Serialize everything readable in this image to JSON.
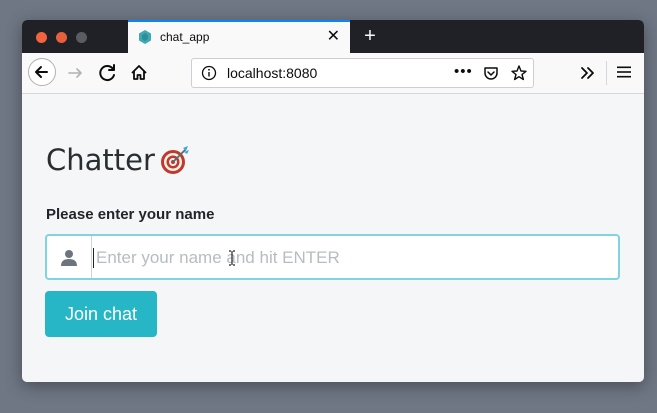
{
  "browser": {
    "tab": {
      "title": "chat_app",
      "close_glyph": "✕"
    },
    "new_tab_glyph": "+",
    "url": "localhost:8080",
    "url_more_glyph": "•••",
    "icons": {
      "back": "back-arrow-icon",
      "forward": "forward-arrow-icon",
      "reload": "reload-icon",
      "home": "home-icon",
      "info": "info-icon",
      "pocket": "pocket-icon",
      "bookmark": "star-icon",
      "overflow": "chevron-double-right-icon",
      "menu": "hamburger-menu-icon"
    },
    "colors": {
      "accent": "#0a84ff",
      "tabbar": "#1f2126"
    }
  },
  "page": {
    "title": "Chatter",
    "title_emoji": "direct-hit-target-icon",
    "name_label": "Please enter your name",
    "name_input": {
      "value": "",
      "placeholder": "Enter your name and hit ENTER"
    },
    "join_button": "Join chat",
    "colors": {
      "primary": "#26b6c6",
      "input_focus_border": "#7fd4e0"
    }
  }
}
